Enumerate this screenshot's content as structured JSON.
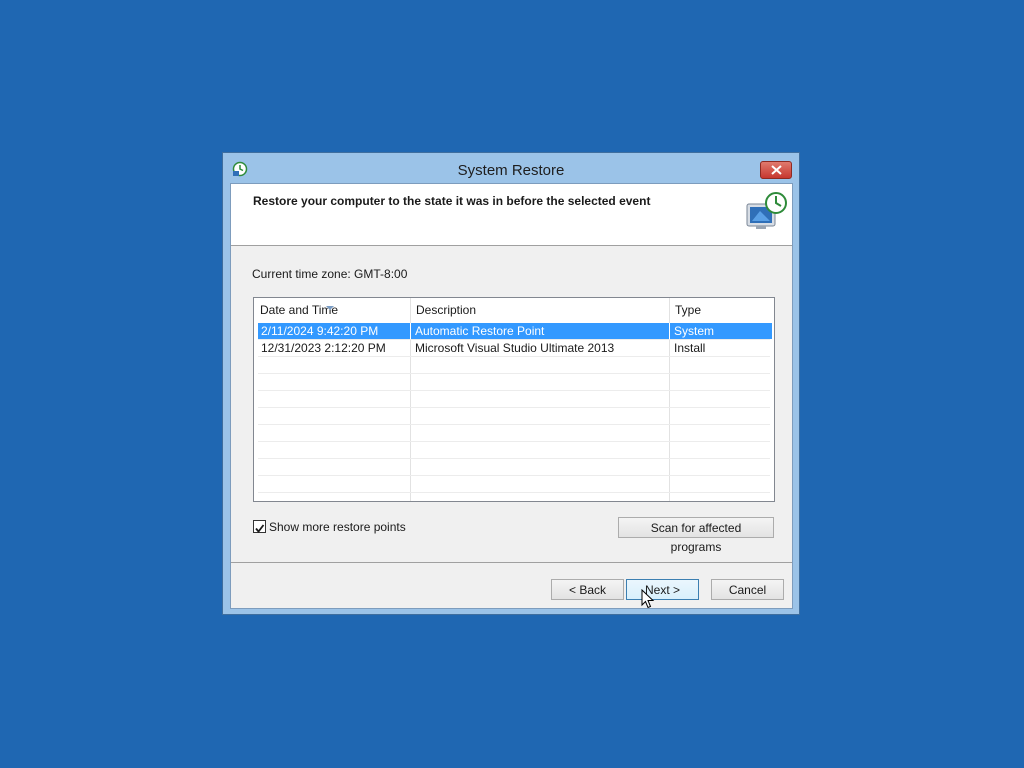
{
  "window": {
    "title": "System Restore"
  },
  "header": {
    "text": "Restore your computer to the state it was in before the selected event"
  },
  "timezone": "Current time zone: GMT-8:00",
  "table": {
    "columns": [
      "Date and Time",
      "Description",
      "Type"
    ],
    "rows": [
      {
        "date": "2/11/2024 9:42:20 PM",
        "description": "Automatic Restore Point",
        "type": "System",
        "selected": true
      },
      {
        "date": "12/31/2023 2:12:20 PM",
        "description": "Microsoft Visual Studio Ultimate 2013",
        "type": "Install",
        "selected": false
      }
    ]
  },
  "checkbox": {
    "label": "Show more restore points",
    "checked": true
  },
  "buttons": {
    "scan": "Scan for affected programs",
    "back": "< Back",
    "next": "Next >",
    "cancel": "Cancel"
  },
  "colors": {
    "desktop": "#1f67b2",
    "selection": "#3399ff"
  }
}
